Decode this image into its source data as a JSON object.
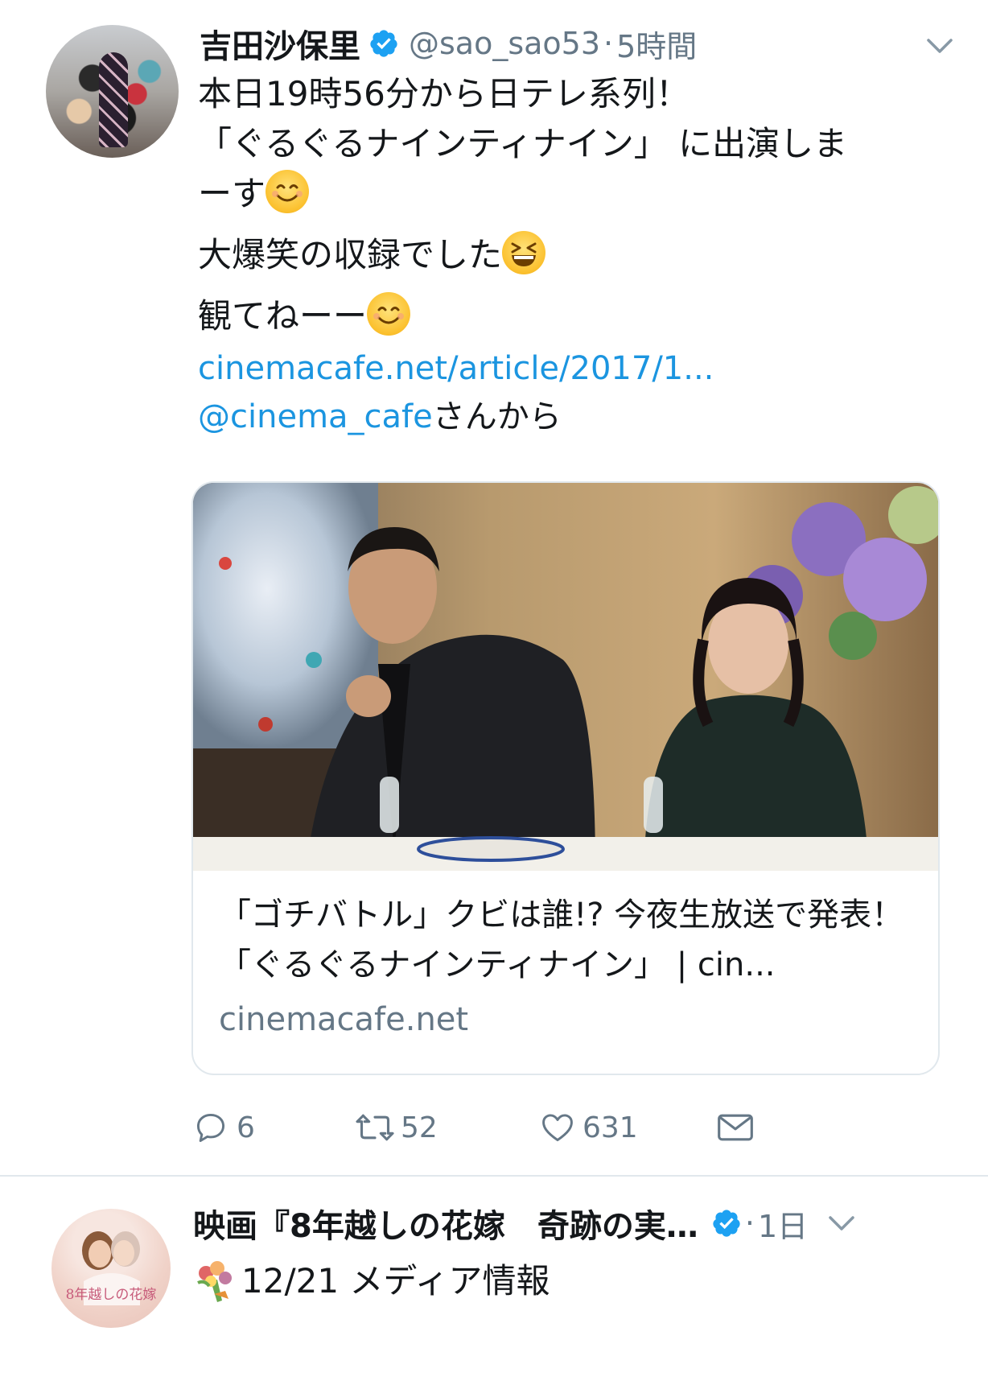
{
  "tweet1": {
    "author_name": "吉田沙保里",
    "handle": "@sao_sao53",
    "time": "5時間",
    "separator": "·",
    "text": {
      "line1": "本日19時56分から日テレ系列！",
      "line2": "「ぐるぐるナインティナイン」 に出演しま",
      "line3": "ーす",
      "line4": "大爆笑の収録でした",
      "line5": "観てねーー",
      "link": "cinemacafe.net/article/2017/1...",
      "mention": "@cinema_cafe",
      "mention_suffix": "さんから"
    },
    "card": {
      "title": "「ゴチバトル」クビは誰!? 今夜生放送で発表！「ぐるぐるナインティナイン」 | cin...",
      "domain": "cinemacafe.net"
    },
    "actions": {
      "replies": "6",
      "retweets": "52",
      "likes": "631"
    }
  },
  "tweet2": {
    "author_name": "映画『8年越しの花嫁　奇跡の実…",
    "separator": "·",
    "time": "1日",
    "text": "12/21 メディア情報",
    "avatar_text": "8年越しの花嫁"
  },
  "colors": {
    "link": "#1b95e0",
    "secondary_text": "#657786",
    "verified": "#1da1f2",
    "divider": "#e1e8ed"
  },
  "icons": [
    "verified-badge-icon",
    "caret-down-icon",
    "reply-icon",
    "retweet-icon",
    "like-icon",
    "dm-icon",
    "smile-emoji-icon",
    "laugh-emoji-icon",
    "bouquet-emoji-icon"
  ]
}
